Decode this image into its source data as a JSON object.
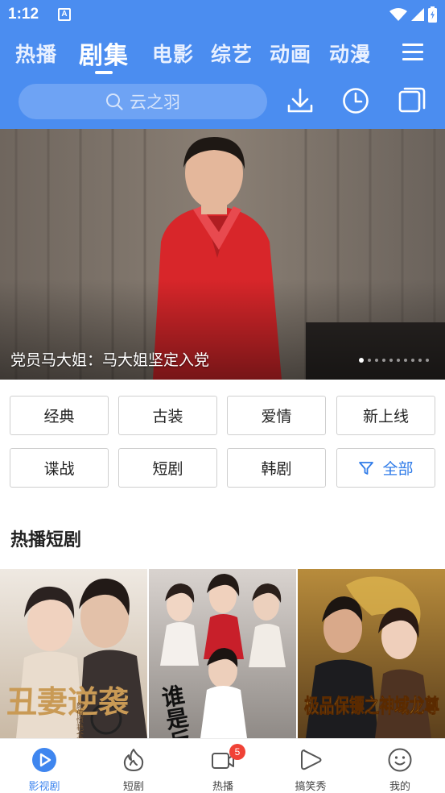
{
  "status_bar": {
    "time": "1:12",
    "a_icon": "A"
  },
  "tabs": [
    {
      "label": "热播",
      "active": false
    },
    {
      "label": "剧集",
      "active": true
    },
    {
      "label": "电影",
      "active": false
    },
    {
      "label": "综艺",
      "active": false
    },
    {
      "label": "动画",
      "active": false
    },
    {
      "label": "动漫",
      "active": false
    }
  ],
  "search": {
    "placeholder": "云之羽"
  },
  "banner": {
    "caption": "党员马大姐：马大姐坚定入党",
    "dot_count": 10,
    "active_dot": 0
  },
  "categories": [
    {
      "label": "经典"
    },
    {
      "label": "古装"
    },
    {
      "label": "爱情"
    },
    {
      "label": "新上线"
    },
    {
      "label": "谍战"
    },
    {
      "label": "短剧"
    },
    {
      "label": "韩剧"
    },
    {
      "label": "全部",
      "icon": "filter-icon"
    }
  ],
  "section": {
    "title": "热播短剧"
  },
  "posters": [
    {
      "title_text": "丑妻逆袭",
      "subtitle": "颜值惊艳全场",
      "accent": "#b8854a"
    },
    {
      "title_text": "谁是反派男主",
      "accent": "#1b1b1b"
    },
    {
      "title_text": "极品保镖之神域龙尊",
      "accent": "#d4b02a"
    }
  ],
  "bottom_nav": [
    {
      "label": "影视剧",
      "icon": "video-play-icon",
      "active": true
    },
    {
      "label": "短剧",
      "icon": "flame-icon",
      "active": false
    },
    {
      "label": "热播",
      "icon": "camera-icon",
      "active": false,
      "badge": "5"
    },
    {
      "label": "搞笑秀",
      "icon": "play-triangle-icon",
      "active": false
    },
    {
      "label": "我的",
      "icon": "smile-icon",
      "active": false
    }
  ],
  "colors": {
    "primary": "#4b8df0",
    "accent_blue": "#2f7be8",
    "badge_red": "#f04236"
  }
}
